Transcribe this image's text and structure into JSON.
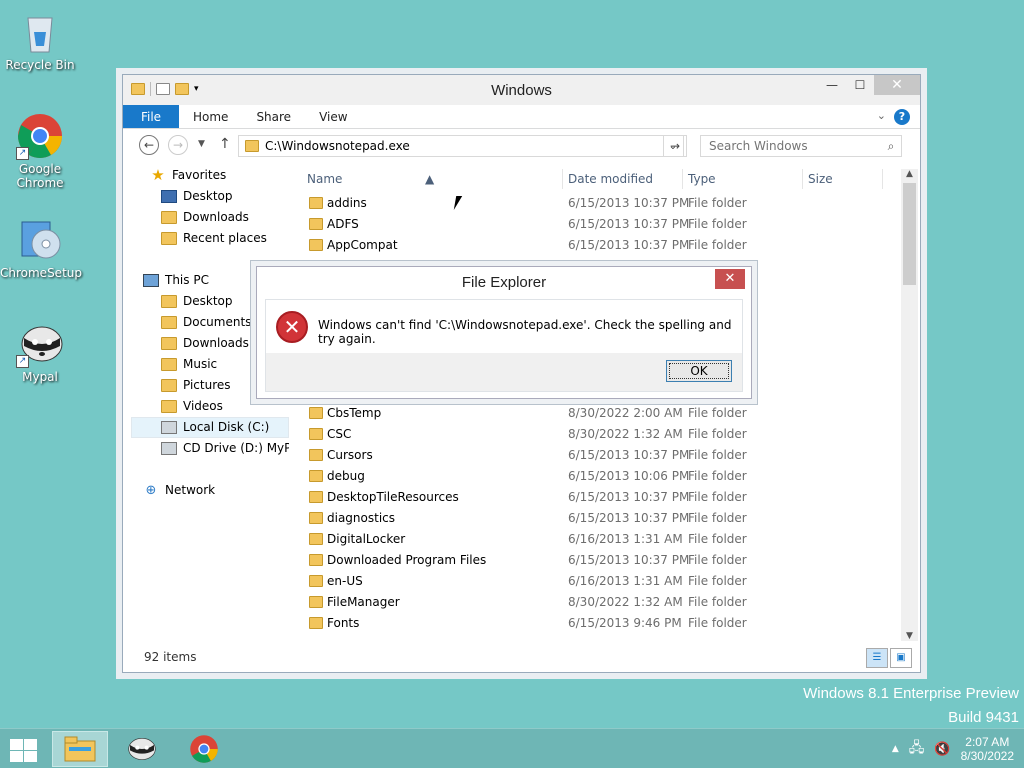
{
  "desktop": {
    "icons": [
      {
        "label": "Recycle Bin",
        "icon": "recycle-bin-icon"
      },
      {
        "label": "Google Chrome",
        "icon": "chrome-icon"
      },
      {
        "label": "ChromeSetup",
        "icon": "setup-disc-icon"
      },
      {
        "label": "Mypal",
        "icon": "raccoon-icon"
      }
    ],
    "watermark": {
      "line1": "Windows 8.1 Enterprise Preview",
      "line2": "Build 9431"
    }
  },
  "explorer": {
    "title": "Windows",
    "ribbon_tabs": {
      "file": "File",
      "home": "Home",
      "share": "Share",
      "view": "View"
    },
    "address": "C:\\Windowsnotepad.exe",
    "search_placeholder": "Search Windows",
    "sidebar": {
      "favorites": "Favorites",
      "desktop": "Desktop",
      "downloads": "Downloads",
      "recent": "Recent places",
      "this_pc": "This PC",
      "pc_desktop": "Desktop",
      "pc_documents": "Documents",
      "pc_downloads": "Downloads",
      "pc_music": "Music",
      "pc_pictures": "Pictures",
      "pc_videos": "Videos",
      "local_disk": "Local Disk (C:)",
      "cd_drive": "CD Drive (D:) MyPal",
      "network": "Network"
    },
    "columns": {
      "name": "Name",
      "date": "Date modified",
      "type": "Type",
      "size": "Size"
    },
    "rows_top": [
      {
        "name": "addins",
        "date": "6/15/2013 10:37 PM",
        "type": "File folder"
      },
      {
        "name": "ADFS",
        "date": "6/15/2013 10:37 PM",
        "type": "File folder"
      },
      {
        "name": "AppCompat",
        "date": "6/15/2013 10:37 PM",
        "type": "File folder"
      }
    ],
    "rows_bottom": [
      {
        "name": "CbsTemp",
        "date": "8/30/2022 2:00 AM",
        "type": "File folder"
      },
      {
        "name": "CSC",
        "date": "8/30/2022 1:32 AM",
        "type": "File folder"
      },
      {
        "name": "Cursors",
        "date": "6/15/2013 10:37 PM",
        "type": "File folder"
      },
      {
        "name": "debug",
        "date": "6/15/2013 10:06 PM",
        "type": "File folder"
      },
      {
        "name": "DesktopTileResources",
        "date": "6/15/2013 10:37 PM",
        "type": "File folder"
      },
      {
        "name": "diagnostics",
        "date": "6/15/2013 10:37 PM",
        "type": "File folder"
      },
      {
        "name": "DigitalLocker",
        "date": "6/16/2013 1:31 AM",
        "type": "File folder"
      },
      {
        "name": "Downloaded Program Files",
        "date": "6/15/2013 10:37 PM",
        "type": "File folder"
      },
      {
        "name": "en-US",
        "date": "6/16/2013 1:31 AM",
        "type": "File folder"
      },
      {
        "name": "FileManager",
        "date": "8/30/2022 1:32 AM",
        "type": "File folder"
      },
      {
        "name": "Fonts",
        "date": "6/15/2013 9:46 PM",
        "type": "File folder"
      }
    ],
    "status": "92 items"
  },
  "dialog": {
    "title": "File Explorer",
    "message": "Windows can't find 'C:\\Windowsnotepad.exe'. Check the spelling and try again.",
    "ok": "OK"
  },
  "taskbar": {
    "time": "2:07 AM",
    "date": "8/30/2022"
  },
  "colors": {
    "accent": "#1979ca",
    "desktop": "#75c8c6",
    "error": "#d13438"
  }
}
